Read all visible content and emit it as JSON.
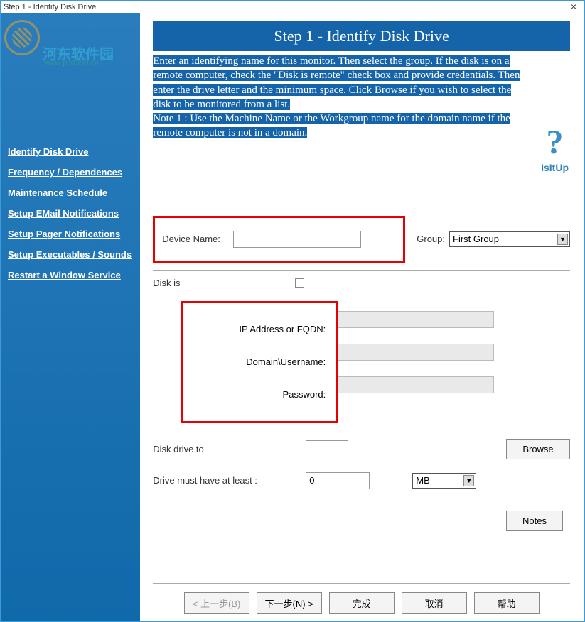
{
  "window": {
    "title": "Step 1 - Identify Disk Drive"
  },
  "watermark": {
    "text": "河东软件园",
    "sub": "www.pc0359.cn"
  },
  "sidebar": {
    "items": [
      {
        "label": "Identify Disk Drive"
      },
      {
        "label": "Frequency / Dependences"
      },
      {
        "label": "Maintenance Schedule"
      },
      {
        "label": "Setup EMail Notifications"
      },
      {
        "label": "Setup Pager Notifications"
      },
      {
        "label": "Setup Executables / Sounds"
      },
      {
        "label": "Restart a Window Service"
      }
    ]
  },
  "header": {
    "title": "Step 1 - Identify Disk Drive"
  },
  "instructions": {
    "p1": "Enter an identifying name for this monitor. Then select the group. If the disk is on a remote computer, check the \"Disk is remote\" check box and provide credentials. Then enter the drive letter and the minimum space. Click Browse if you wish to select the disk to be monitored from a list.",
    "p2": "Note 1 : Use the Machine Name or the Workgroup name for the domain name if the remote computer is not in a domain."
  },
  "brand": {
    "name": "IsItUp"
  },
  "form": {
    "device_name_label": "Device Name:",
    "device_name_value": "",
    "group_label": "Group:",
    "group_value": "First Group",
    "disk_is_label": "Disk is",
    "ip_label": "IP Address or FQDN:",
    "ip_value": "",
    "domain_user_label": "Domain\\Username:",
    "domain_user_value": "",
    "password_label": "Password:",
    "password_value": "",
    "disk_drive_label": "Disk drive to",
    "disk_drive_value": "",
    "browse_label": "Browse",
    "drive_min_label": "Drive must have at least :",
    "drive_min_value": "0",
    "drive_min_unit": "MB",
    "notes_label": "Notes"
  },
  "buttons": {
    "back": "< 上一步(B)",
    "next": "下一步(N) >",
    "finish": "完成",
    "cancel": "取消",
    "help": "帮助"
  }
}
